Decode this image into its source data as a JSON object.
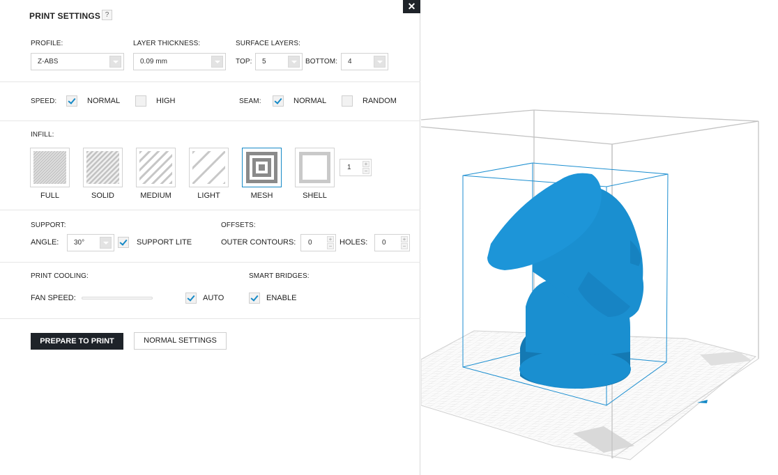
{
  "header": {
    "title": "PRINT SETTINGS",
    "help": "?",
    "close": "✕"
  },
  "profile": {
    "label": "PROFILE:",
    "value": "Z-ABS"
  },
  "layer_thickness": {
    "label": "LAYER THICKNESS:",
    "value": "0.09 mm"
  },
  "surface_layers": {
    "label": "SURFACE LAYERS:",
    "top_label": "TOP:",
    "top_value": "5",
    "bottom_label": "BOTTOM:",
    "bottom_value": "4"
  },
  "speed": {
    "label": "SPEED:",
    "normal": "NORMAL",
    "high": "HIGH",
    "normal_checked": true,
    "high_checked": false
  },
  "seam": {
    "label": "SEAM:",
    "normal": "NORMAL",
    "random": "RANDOM",
    "normal_checked": true,
    "random_checked": false
  },
  "infill": {
    "label": "INFILL:",
    "options": [
      "FULL",
      "SOLID",
      "MEDIUM",
      "LIGHT",
      "MESH",
      "SHELL"
    ],
    "selected": "MESH",
    "shell_count": "1"
  },
  "support": {
    "label": "SUPPORT:",
    "angle_label": "ANGLE:",
    "angle_value": "30°",
    "lite_label": "SUPPORT LITE",
    "lite_checked": true
  },
  "offsets": {
    "label": "OFFSETS:",
    "outer_label": "OUTER CONTOURS:",
    "outer_value": "0",
    "holes_label": "HOLES:",
    "holes_value": "0"
  },
  "cooling": {
    "label": "PRINT COOLING:",
    "fan_label": "FAN SPEED:",
    "auto_label": "AUTO",
    "auto_checked": true
  },
  "bridges": {
    "label": "SMART BRIDGES:",
    "enable_label": "ENABLE",
    "enable_checked": true
  },
  "actions": {
    "prepare": "PREPARE TO PRINT",
    "normal_settings": "NORMAL SETTINGS"
  },
  "colors": {
    "accent": "#1589c6",
    "model": "#1a8fd0",
    "dark": "#1e2329"
  }
}
